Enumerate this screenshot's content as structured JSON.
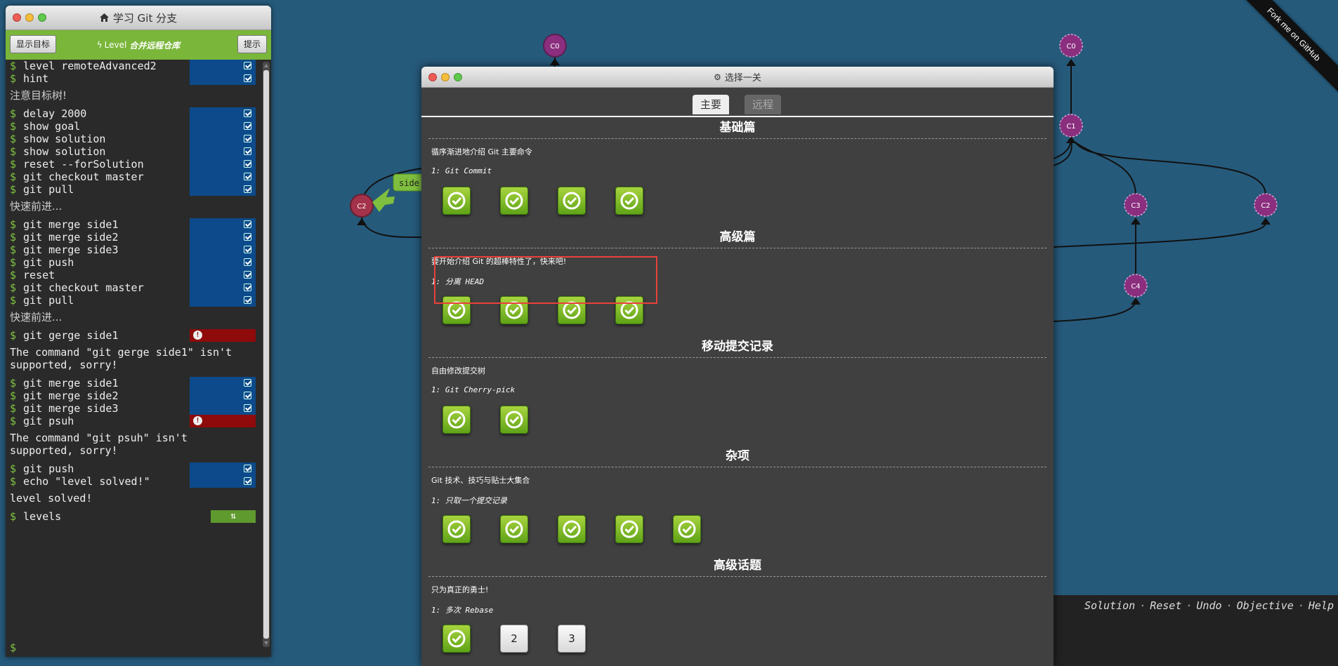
{
  "terminal": {
    "title": "学习 Git 分支",
    "show_goal_label": "显示目标",
    "hint_label": "提示",
    "level_prefix": "Level",
    "level_name": "合并远程仓库",
    "prompt": "$",
    "lines": [
      {
        "kind": "cmd",
        "text": "level remoteAdvanced2",
        "status": "ok"
      },
      {
        "kind": "cmd",
        "text": "hint",
        "status": "ok"
      },
      {
        "kind": "msg",
        "text": "注意目标树!",
        "cn": true
      },
      {
        "kind": "cmd",
        "text": "delay 2000",
        "status": "ok"
      },
      {
        "kind": "cmd",
        "text": "show goal",
        "status": "ok"
      },
      {
        "kind": "cmd",
        "text": "show solution",
        "status": "ok"
      },
      {
        "kind": "cmd",
        "text": "show solution",
        "status": "ok"
      },
      {
        "kind": "cmd",
        "text": "reset --forSolution",
        "status": "ok"
      },
      {
        "kind": "cmd",
        "text": "git checkout master",
        "status": "ok"
      },
      {
        "kind": "cmd",
        "text": "git pull",
        "status": "ok"
      },
      {
        "kind": "msg",
        "text": "快速前进...",
        "cn": true
      },
      {
        "kind": "cmd",
        "text": "git merge side1",
        "status": "ok"
      },
      {
        "kind": "cmd",
        "text": "git merge side2",
        "status": "ok"
      },
      {
        "kind": "cmd",
        "text": "git merge side3",
        "status": "ok"
      },
      {
        "kind": "cmd",
        "text": "git push",
        "status": "ok"
      },
      {
        "kind": "cmd",
        "text": "reset",
        "status": "ok"
      },
      {
        "kind": "cmd",
        "text": "git checkout master",
        "status": "ok"
      },
      {
        "kind": "cmd",
        "text": "git pull",
        "status": "ok"
      },
      {
        "kind": "msg",
        "text": "快速前进...",
        "cn": true
      },
      {
        "kind": "cmd",
        "text": "git gerge side1",
        "status": "err"
      },
      {
        "kind": "msg",
        "text": "The command \"git gerge side1\" isn't\nsupported, sorry!",
        "cn": false
      },
      {
        "kind": "cmd",
        "text": "git merge side1",
        "status": "ok"
      },
      {
        "kind": "cmd",
        "text": "git merge side2",
        "status": "ok"
      },
      {
        "kind": "cmd",
        "text": "git merge side3",
        "status": "ok"
      },
      {
        "kind": "cmd",
        "text": "git psuh",
        "status": "err"
      },
      {
        "kind": "msg",
        "text": "The command \"git psuh\" isn't\nsupported, sorry!",
        "cn": false
      },
      {
        "kind": "cmd",
        "text": "git push",
        "status": "ok"
      },
      {
        "kind": "cmd",
        "text": "echo \"level solved!\"",
        "status": "ok"
      },
      {
        "kind": "msg",
        "text": "level solved!",
        "cn": false
      },
      {
        "kind": "cmd",
        "text": "levels",
        "status": "levels"
      }
    ]
  },
  "graph": {
    "commits": {
      "c0_local": "C0",
      "c2_local": "C2",
      "c0_remote": "C0",
      "c1_remote": "C1",
      "c3_remote": "C3",
      "c2_remote": "C2",
      "c4_remote": "C4"
    },
    "branch_label": "side",
    "colors": {
      "background": "#265a7b",
      "commit_purple": "#8b2e7e",
      "commit_red": "#a3324a",
      "branch_green": "#7fbf3f"
    }
  },
  "ribbon": {
    "text": "Fork me on GitHub"
  },
  "bottom_links": [
    "Solution",
    "Reset",
    "Undo",
    "Objective",
    "Help"
  ],
  "modal": {
    "title": "选择一关",
    "tabs": {
      "main": "主要",
      "remote": "远程"
    },
    "sections": [
      {
        "title": "基础篇",
        "desc": "循序渐进地介绍 Git 主要命令",
        "seq": "1: Git Commit",
        "levels": [
          "solved",
          "solved",
          "solved",
          "solved"
        ]
      },
      {
        "title": "高级篇",
        "desc": "要开始介绍 Git 的超棒特性了，快来吧!",
        "seq": "1: 分离 HEAD",
        "levels": [
          "solved",
          "solved",
          "solved",
          "solved"
        ]
      },
      {
        "title": "移动提交记录",
        "desc": "自由修改提交树",
        "seq": "1: Git Cherry-pick",
        "levels": [
          "solved",
          "solved"
        ]
      },
      {
        "title": "杂项",
        "desc": "Git 技术、技巧与贴士大集合",
        "seq": "1: 只取一个提交记录",
        "levels": [
          "solved",
          "solved",
          "solved",
          "solved",
          "solved"
        ]
      },
      {
        "title": "高级话题",
        "desc": "只为真正的勇士!",
        "seq": "1: 多次 Rebase",
        "levels": [
          "solved",
          "2",
          "3"
        ]
      }
    ]
  }
}
